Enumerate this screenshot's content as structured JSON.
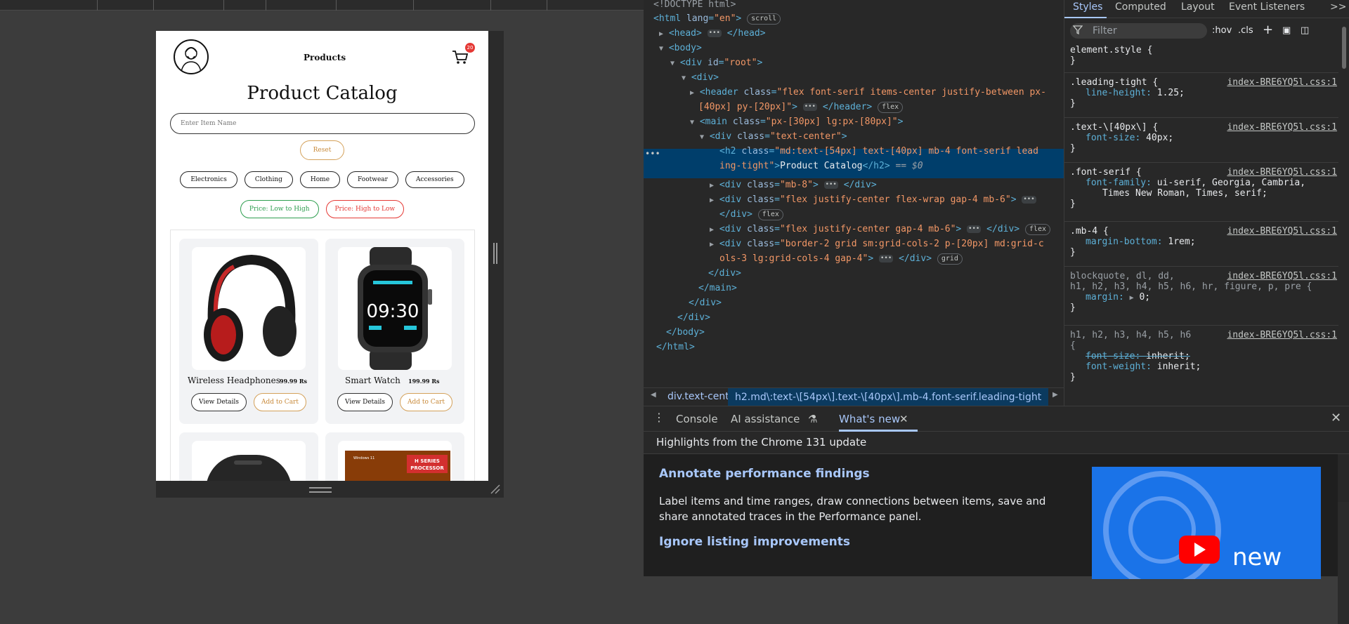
{
  "app": {
    "nav_label": "Products",
    "cart_count": "20",
    "title": "Product Catalog",
    "search_placeholder": "Enter Item Name",
    "reset_label": "Reset",
    "categories": [
      "Electronics",
      "Clothing",
      "Home",
      "Footwear",
      "Accessories"
    ],
    "sort_low": "Price: Low to High",
    "sort_high": "Price: High to Low",
    "products": [
      {
        "name": "Wireless Headphones",
        "price": "99.99 Rs",
        "image_icon": "headphones-icon"
      },
      {
        "name": "Smart Watch",
        "price": "199.99 Rs",
        "image_icon": "smartwatch-icon",
        "watch_time": "09:30"
      },
      {
        "name": "",
        "price": "",
        "image_icon": "speaker-icon"
      },
      {
        "name": "",
        "price": "",
        "image_icon": "laptop-icon",
        "badge_line1": "H SERIES",
        "badge_line2": "PROCESSOR",
        "os_label": "Windows 11"
      }
    ],
    "view_label": "View Details",
    "cart_label": "Add to Cart"
  },
  "elements": {
    "l0": "<!DOCTYPE html>",
    "html_open": "<html",
    "html_attr": "lang",
    "html_val": "\"en\"",
    "scroll_pill": "scroll",
    "head": "<head>",
    "head_close": "</head>",
    "body": "<body>",
    "root_tag": "<div",
    "root_attr": "id",
    "root_val": "\"root\"",
    "div": "<div>",
    "header_tag": "<header",
    "header_attr": "class",
    "header_val1": "\"flex font-serif items-center justify-between px-",
    "header_val2": "[40px] py-[20px]\"",
    "header_close": "</header>",
    "flex_pill": "flex",
    "main_tag": "<main",
    "main_val": "\"px-[30px] lg:px-[80px]\"",
    "tc_val": "\"text-center\"",
    "h2_tag": "<h2",
    "h2_val1": "\"md:text-[54px] text-[40px]  mb-4 font-serif lead",
    "h2_val2": "ing-tight\"",
    "h2_text": "Product Catalog",
    "h2_close": "</h2>",
    "eq": "== $0",
    "mb8_val": "\"mb-8\"",
    "div_close": "</div>",
    "fw_val": "\"flex justify-center flex-wrap gap-4 mb-6\"",
    "fj_val": "\"flex justify-center gap-4 mb-6\"",
    "grid_val1": "\"border-2 grid sm:grid-cols-2 p-[20px] md:grid-c",
    "grid_val2": "ols-3 lg:grid-cols-4 gap-4\"",
    "grid_pill": "grid",
    "main_close": "</main>",
    "body_close": "</body>",
    "html_close": "</html>",
    "crumb1": "div.text-center",
    "crumb2": "h2.md\\:text-\\[54px\\].text-\\[40px\\].mb-4.font-serif.leading-tight"
  },
  "styles": {
    "tabs": [
      "Styles",
      "Computed",
      "Layout",
      "Event Listeners"
    ],
    "more": ">>",
    "filter_placeholder": "Filter",
    "hov": ":hov",
    "cls": ".cls",
    "src": "index-BRE6YQ5l.css:1",
    "rules": [
      {
        "selector": "element.style {",
        "props": [],
        "close": "}"
      },
      {
        "selector": ".leading-tight {",
        "props": [
          [
            "line-height",
            "1.25;"
          ]
        ],
        "close": "}"
      },
      {
        "selector": ".text-\\[40px\\] {",
        "props": [
          [
            "font-size",
            "40px;"
          ]
        ],
        "close": "}"
      },
      {
        "selector": ".font-serif {",
        "props": [
          [
            "font-family",
            "ui-serif, Georgia, Cambria,"
          ]
        ],
        "extra": "Times New Roman, Times, serif;",
        "close": "}"
      },
      {
        "selector": ".mb-4 {",
        "props": [
          [
            "margin-bottom",
            "1rem;"
          ]
        ],
        "close": "}"
      },
      {
        "selector": "blockquote, dl, dd,",
        "selector2": "h1, h2, h3, h4, h5, h6, hr, figure, p, pre {",
        "props": [
          [
            "margin",
            "0;"
          ]
        ],
        "close": "}"
      },
      {
        "selector": "h1, h2, h3, h4, h5, h6",
        "selector2": "{",
        "props": [
          [
            "font-size",
            "inherit;"
          ],
          [
            "font-weight",
            "inherit;"
          ]
        ],
        "close": "}"
      }
    ]
  },
  "drawer": {
    "tabs": [
      "Console",
      "AI assistance",
      "What's new"
    ],
    "subtitle": "Highlights from the Chrome 131 update",
    "heading1": "Annotate performance findings",
    "para": "Label items and time ranges, draw connections between items, save and share annotated traces in the Performance panel.",
    "heading2": "Ignore listing improvements",
    "thumb_text": "new"
  },
  "colors": {
    "accent": "#a8c7fa",
    "selection": "#003e6b",
    "cart_badge": "#e53935",
    "sort_low": "#2e9e4f",
    "sort_high": "#e53935",
    "cart_btn": "#d4a15a"
  }
}
